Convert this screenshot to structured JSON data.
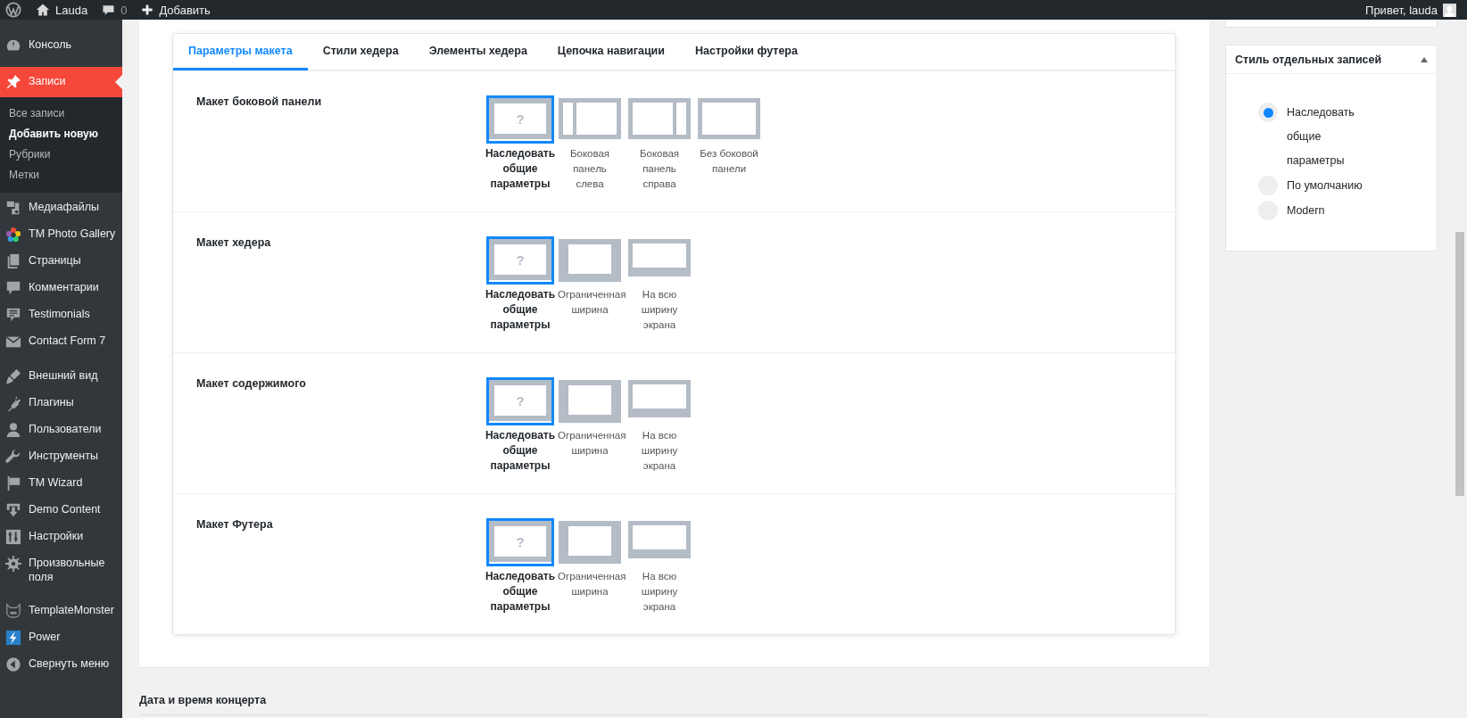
{
  "admin_bar": {
    "site": "Lauda",
    "comments": "0",
    "new": "Добавить",
    "greeting": "Привет, lauda"
  },
  "sidebar": {
    "items": [
      {
        "label": "Консоль",
        "selected": false
      },
      {
        "label": "Записи",
        "selected": true,
        "children": [
          {
            "label": "Все записи",
            "selected": false
          },
          {
            "label": "Добавить новую",
            "selected": true
          },
          {
            "label": "Рубрики",
            "selected": false
          },
          {
            "label": "Метки",
            "selected": false
          }
        ]
      },
      {
        "label": "Медиафайлы",
        "selected": false
      },
      {
        "label": "TM Photo Gallery",
        "selected": false
      },
      {
        "label": "Страницы",
        "selected": false
      },
      {
        "label": "Комментарии",
        "selected": false
      },
      {
        "label": "Testimonials",
        "selected": false
      },
      {
        "label": "Contact Form 7",
        "selected": false
      },
      {
        "label": "Внешний вид",
        "selected": false
      },
      {
        "label": "Плагины",
        "selected": false
      },
      {
        "label": "Пользователи",
        "selected": false
      },
      {
        "label": "Инструменты",
        "selected": false
      },
      {
        "label": "TM Wizard",
        "selected": false
      },
      {
        "label": "Demo Content",
        "selected": false
      },
      {
        "label": "Настройки",
        "selected": false
      },
      {
        "label": "Произвольные поля",
        "selected": false
      },
      {
        "label": "TemplateMonster",
        "selected": false
      },
      {
        "label": "Power",
        "selected": false
      },
      {
        "label": "Свернуть меню",
        "selected": false
      }
    ]
  },
  "tabs": [
    {
      "label": "Параметры макета",
      "selected": true
    },
    {
      "label": "Стили хедера",
      "selected": false
    },
    {
      "label": "Элементы хедера",
      "selected": false
    },
    {
      "label": "Цепочка навигации",
      "selected": false
    },
    {
      "label": "Настройки футера",
      "selected": false
    }
  ],
  "sections": [
    {
      "label": "Макет боковой панели",
      "options": [
        {
          "kind": "inherit",
          "glyph": "?",
          "label": "Наследовать общие параметры",
          "selected": true
        },
        {
          "kind": "left",
          "label": "Боковая панель слева",
          "selected": false
        },
        {
          "kind": "right",
          "label": "Боковая панель справа",
          "selected": false
        },
        {
          "kind": "none",
          "label": "Без боковой панели",
          "selected": false
        }
      ]
    },
    {
      "label": "Макет хедера",
      "options": [
        {
          "kind": "inherit",
          "glyph": "?",
          "label": "Наследовать общие параметры",
          "selected": true
        },
        {
          "kind": "boxed",
          "label": "Ограниченная ширина",
          "selected": false
        },
        {
          "kind": "full",
          "label": "На всю ширину экрана",
          "selected": false
        }
      ]
    },
    {
      "label": "Макет содержимого",
      "options": [
        {
          "kind": "inherit",
          "glyph": "?",
          "label": "Наследовать общие параметры",
          "selected": true
        },
        {
          "kind": "boxed",
          "label": "Ограниченная ширина",
          "selected": false
        },
        {
          "kind": "full",
          "label": "На всю ширину экрана",
          "selected": false
        }
      ]
    },
    {
      "label": "Макет Футера",
      "options": [
        {
          "kind": "inherit",
          "glyph": "?",
          "label": "Наследовать общие параметры",
          "selected": true
        },
        {
          "kind": "boxed",
          "label": "Ограниченная ширина",
          "selected": false
        },
        {
          "kind": "full",
          "label": "На всю ширину экрана",
          "selected": false
        }
      ]
    }
  ],
  "single_post_style": {
    "title": "Стиль отдельных записей",
    "expanded": true,
    "options": [
      {
        "label": "Наследовать общие параметры",
        "selected": true
      },
      {
        "label": "По умолчанию",
        "selected": false
      },
      {
        "label": "Modern",
        "selected": false
      }
    ]
  },
  "next_section": {
    "title": "Дата и время концерта"
  }
}
